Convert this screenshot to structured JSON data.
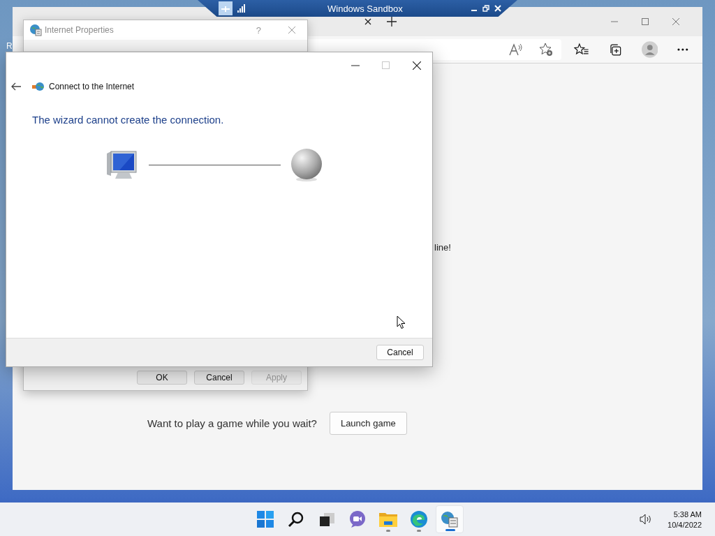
{
  "sandbox_bar": {
    "title": "Windows Sandbox"
  },
  "desktop": {
    "label": "R"
  },
  "browser": {
    "page_text": "line!",
    "game_prompt": "Want to play a game while you wait?",
    "launch_button": "Launch game"
  },
  "internet_properties": {
    "title": "Internet Properties",
    "help": "?",
    "buttons": [
      {
        "label": "OK",
        "disabled": false
      },
      {
        "label": "Cancel",
        "disabled": false
      },
      {
        "label": "Apply",
        "disabled": true
      }
    ]
  },
  "wizard": {
    "title": "Connect to the Internet",
    "heading": "The wizard cannot create the connection.",
    "maximize_disabled": true,
    "buttons": [
      {
        "label": "Cancel",
        "disabled": false
      }
    ]
  },
  "taskbar": {
    "apps": [
      {
        "kind": "start",
        "running": false,
        "selected": false
      },
      {
        "kind": "search",
        "running": false,
        "selected": false
      },
      {
        "kind": "taskview",
        "running": false,
        "selected": false
      },
      {
        "kind": "chat",
        "running": false,
        "selected": false
      },
      {
        "kind": "explorer",
        "running": true,
        "selected": false
      },
      {
        "kind": "edge",
        "running": true,
        "selected": false
      },
      {
        "kind": "inetprops",
        "running": true,
        "selected": true
      }
    ],
    "time": "5:38 AM",
    "date": "10/4/2022"
  }
}
